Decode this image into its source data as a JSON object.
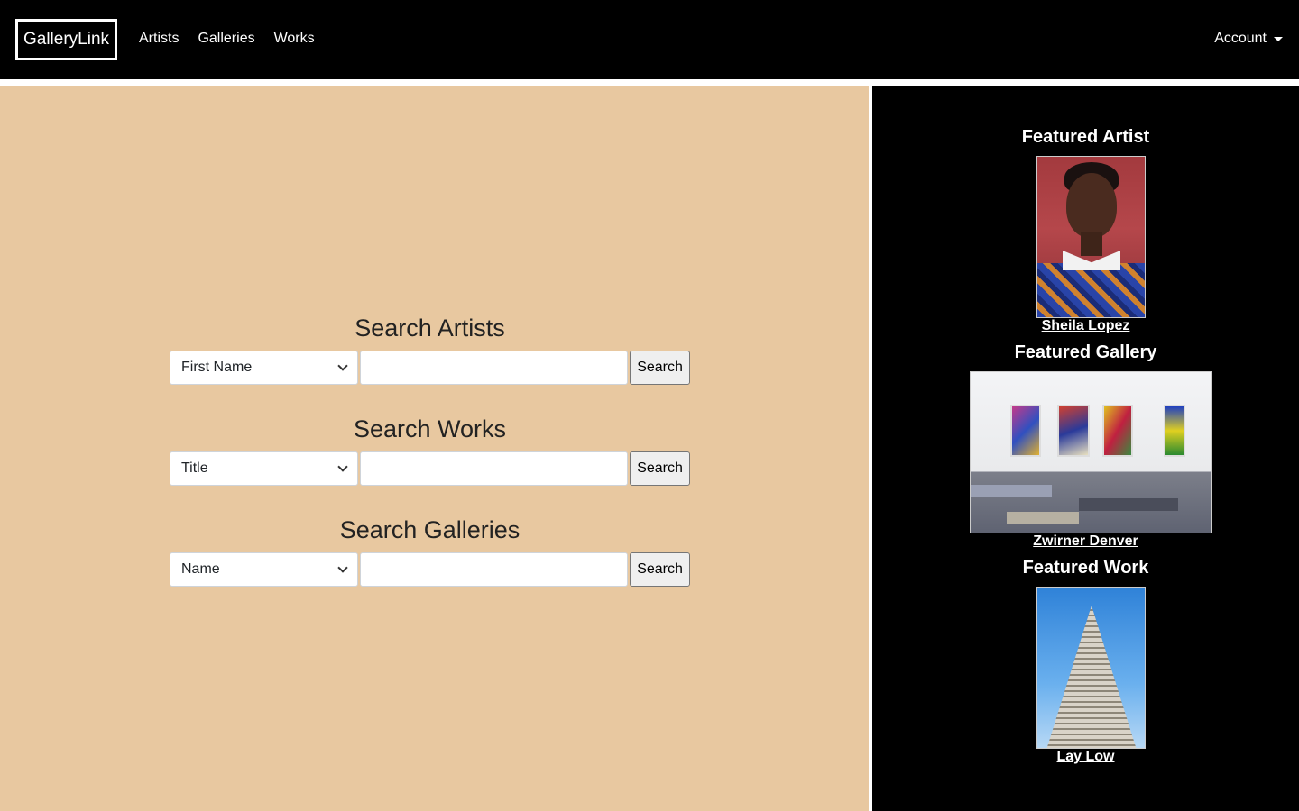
{
  "navbar": {
    "brand": "GalleryLink",
    "links": [
      "Artists",
      "Galleries",
      "Works"
    ],
    "account": "Account"
  },
  "search": {
    "artists": {
      "title": "Search Artists",
      "select": "First Name",
      "button": "Search"
    },
    "works": {
      "title": "Search Works",
      "select": "Title",
      "button": "Search"
    },
    "galleries": {
      "title": "Search Galleries",
      "select": "Name",
      "button": "Search"
    }
  },
  "featured": {
    "artist": {
      "title": "Featured Artist",
      "name": "Sheila Lopez"
    },
    "gallery": {
      "title": "Featured Gallery",
      "name": "Zwirner Denver"
    },
    "work": {
      "title": "Featured Work",
      "name": "Lay Low"
    }
  },
  "colors": {
    "main_bg": "#e8c8a0",
    "nav_bg": "#000000",
    "sidebar_bg": "#000000"
  }
}
